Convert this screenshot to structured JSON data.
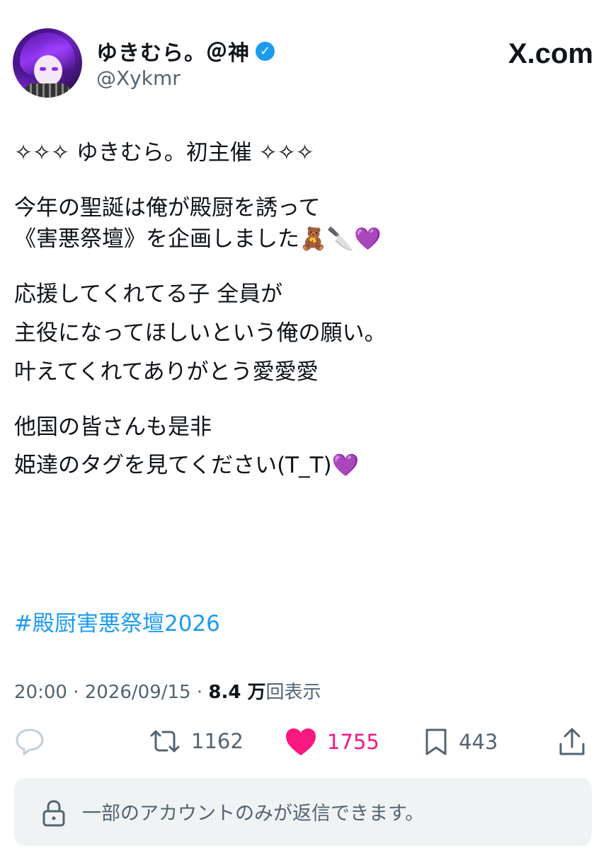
{
  "header": {
    "display_name": "ゆきむら。＠神",
    "verified_icon": "verified-badge-icon",
    "handle": "@Xykmr",
    "brand": "X.com",
    "brand_color": "#0f1419"
  },
  "tweet": {
    "lines": [
      "✧✧✧ ゆきむら。初主催 ✧✧✧",
      "",
      "今年の聖誕は俺が殿厨を誘って",
      "《害悪祭壇》を企画しました🧸🔪💜",
      "",
      "応援してくれてる子 全員が",
      "主役になってほしいという俺の願い。",
      "叶えてくれてありがとう愛愛愛",
      "",
      "他国の皆さんも是非",
      "姫達のタグを見てください(T_T)💜"
    ],
    "hashtag": "#殿厨害悪祭壇2026"
  },
  "meta": {
    "time": "20:00",
    "date": "2026/09/15",
    "views": "8.4 万",
    "views_label": "回表示",
    "separator": " · "
  },
  "actions": {
    "reply_icon": "reply-icon",
    "retweet_count": "1162",
    "like_count": "1755",
    "bookmark_count": "443",
    "share_icon": "share-icon",
    "like_color": "#f91880",
    "muted_color": "#536471"
  },
  "reply_restriction": {
    "text": "一部のアカウントのみが返信できます。",
    "icon": "lock-icon"
  },
  "colors": {
    "link": "#1d9bf0",
    "reply_box_bg": "#eff3f4"
  }
}
